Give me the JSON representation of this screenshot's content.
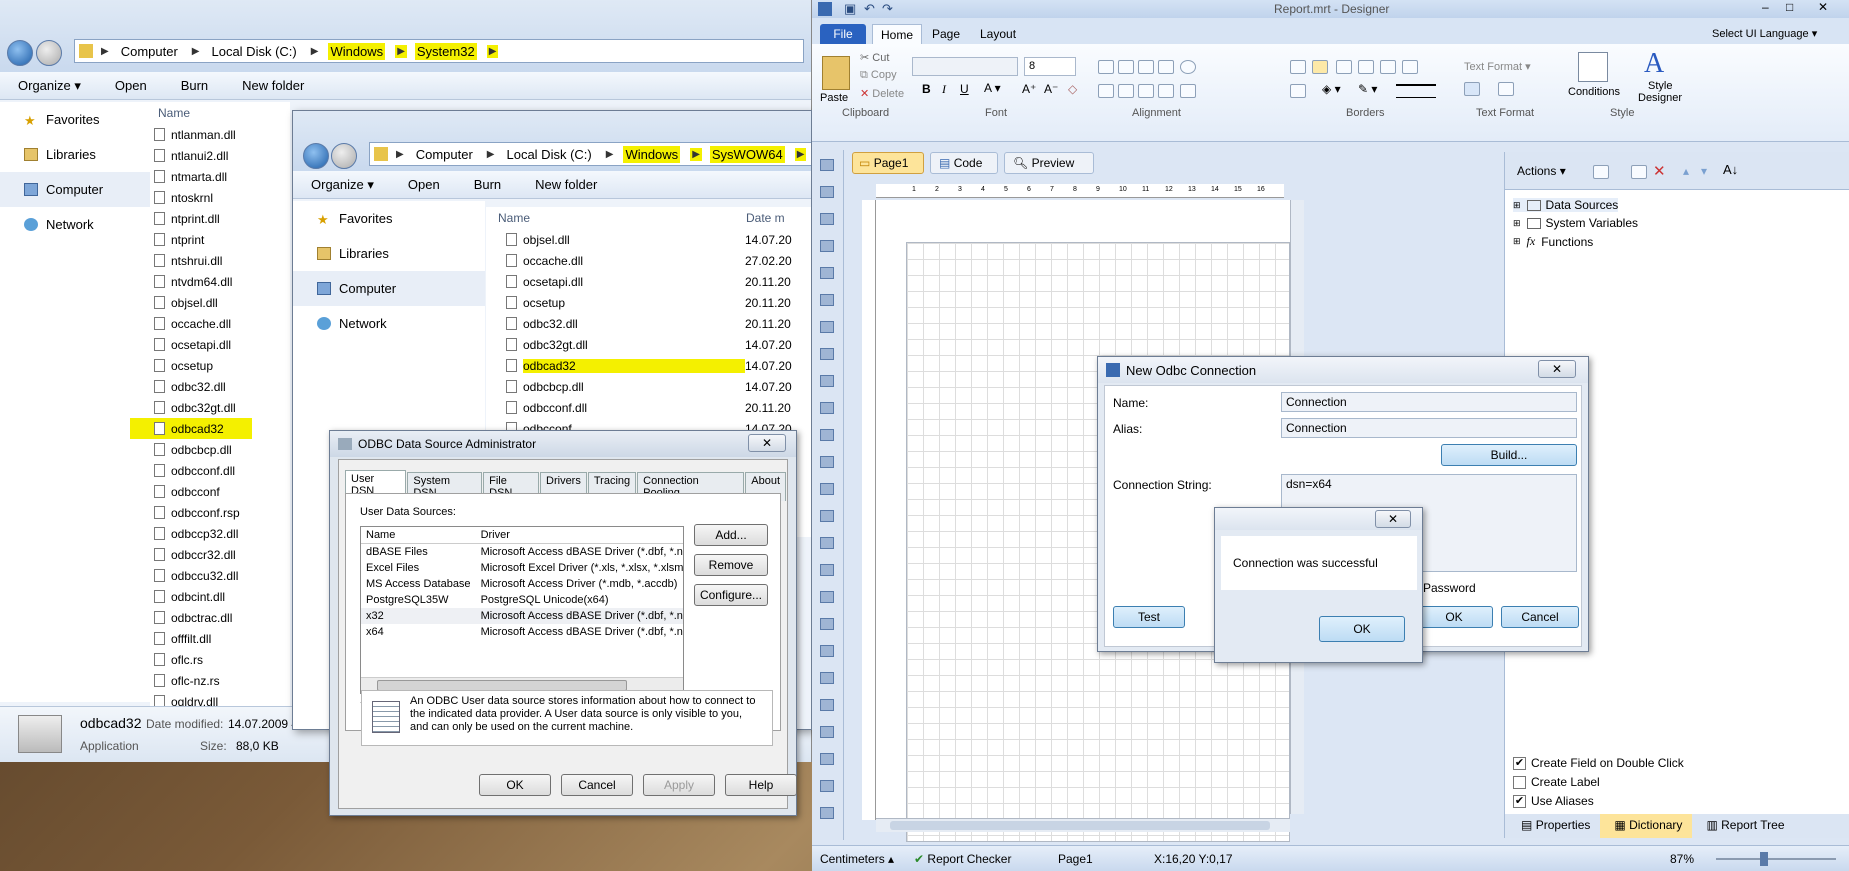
{
  "explorer1": {
    "crumbs": [
      "Computer",
      "Local Disk (C:)",
      "Windows",
      "System32"
    ],
    "toolbar": {
      "organize": "Organize",
      "open": "Open",
      "burn": "Burn",
      "new_folder": "New folder"
    },
    "nav": {
      "favorites": "Favorites",
      "libraries": "Libraries",
      "computer": "Computer",
      "network": "Network"
    },
    "col_name": "Name",
    "files": [
      "ntlanman.dll",
      "ntlanui2.dll",
      "ntmarta.dll",
      "ntoskrnl",
      "ntprint.dll",
      "ntprint",
      "ntshrui.dll",
      "ntvdm64.dll",
      "objsel.dll",
      "occache.dll",
      "ocsetapi.dll",
      "ocsetup",
      "odbc32.dll",
      "odbc32gt.dll",
      "odbcad32",
      "odbcbcp.dll",
      "odbcconf.dll",
      "odbcconf",
      "odbcconf.rsp",
      "odbccp32.dll",
      "odbccr32.dll",
      "odbccu32.dll",
      "odbcint.dll",
      "odbctrac.dll",
      "offfilt.dll",
      "oflc.rs",
      "oflc-nz.rs",
      "ogldrv.dll"
    ],
    "details": {
      "name": "odbcad32",
      "modified_label": "Date modified:",
      "modified": "14.07.2009 4",
      "type": "Application",
      "size_label": "Size:",
      "size": "88,0 KB"
    }
  },
  "explorer2": {
    "crumbs": [
      "Computer",
      "Local Disk (C:)",
      "Windows",
      "SysWOW64"
    ],
    "toolbar": {
      "organize": "Organize",
      "open": "Open",
      "burn": "Burn",
      "new_folder": "New folder"
    },
    "nav": {
      "favorites": "Favorites",
      "libraries": "Libraries",
      "computer": "Computer",
      "network": "Network"
    },
    "col_name": "Name",
    "col_date": "Date m",
    "files": [
      {
        "name": "objsel.dll",
        "date": "14.07.20"
      },
      {
        "name": "occache.dll",
        "date": "27.02.20"
      },
      {
        "name": "ocsetapi.dll",
        "date": "20.11.20"
      },
      {
        "name": "ocsetup",
        "date": "20.11.20"
      },
      {
        "name": "odbc32.dll",
        "date": "20.11.20"
      },
      {
        "name": "odbc32gt.dll",
        "date": "14.07.20"
      },
      {
        "name": "odbcad32",
        "date": "14.07.20"
      },
      {
        "name": "odbcbcp.dll",
        "date": "14.07.20"
      },
      {
        "name": "odbcconf.dll",
        "date": "20.11.20"
      },
      {
        "name": "odbcconf",
        "date": "14.07.20"
      }
    ]
  },
  "odbc_admin": {
    "title": "ODBC Data Source Administrator",
    "tabs": [
      "User DSN",
      "System DSN",
      "File DSN",
      "Drivers",
      "Tracing",
      "Connection Pooling",
      "About"
    ],
    "sources_label": "User Data Sources:",
    "col_name": "Name",
    "col_driver": "Driver",
    "rows": [
      {
        "name": "dBASE Files",
        "driver": "Microsoft Access dBASE Driver (*.dbf, *.ndx"
      },
      {
        "name": "Excel Files",
        "driver": "Microsoft Excel Driver (*.xls, *.xlsx, *.xlsm, *.x"
      },
      {
        "name": "MS Access Database",
        "driver": "Microsoft Access Driver (*.mdb, *.accdb)"
      },
      {
        "name": "PostgreSQL35W",
        "driver": "PostgreSQL Unicode(x64)"
      },
      {
        "name": "x32",
        "driver": "Microsoft Access dBASE Driver (*.dbf, *.ndx"
      },
      {
        "name": "x64",
        "driver": "Microsoft Access dBASE Driver (*.dbf, *.ndx"
      }
    ],
    "buttons": {
      "add": "Add...",
      "remove": "Remove",
      "configure": "Configure..."
    },
    "info_lines": [
      "An ODBC User data source stores information about how to connect to",
      "the indicated data provider.   A User data source is only visible to you,",
      "and can only be used on the current machine."
    ],
    "footer": {
      "ok": "OK",
      "cancel": "Cancel",
      "apply": "Apply",
      "help": "Help"
    }
  },
  "designer": {
    "title": "Report.mrt - Designer",
    "file_tab": "File",
    "ribbon_tabs": [
      "Home",
      "Page",
      "Layout"
    ],
    "select_language": "Select UI Language",
    "clipboard": {
      "paste": "Paste",
      "cut": "Cut",
      "copy": "Copy",
      "delete": "Delete",
      "label": "Clipboard"
    },
    "font": {
      "size": "8",
      "label": "Font"
    },
    "alignment_label": "Alignment",
    "borders_label": "Borders",
    "text_format": {
      "button": "Text Format",
      "label": "Text Format"
    },
    "style": {
      "conditions": "Conditions",
      "style_designer_1": "Style",
      "style_designer_2": "Designer",
      "label": "Style"
    },
    "doc_tabs": [
      "Page1",
      "Code",
      "Preview"
    ],
    "ruler_marks": [
      "1",
      "2",
      "3",
      "4",
      "5",
      "6",
      "7",
      "8",
      "9",
      "10",
      "11",
      "12",
      "13",
      "14",
      "15",
      "16"
    ],
    "dictionary": {
      "actions": "Actions",
      "tree": [
        "Data Sources",
        "System Variables",
        "Functions"
      ],
      "options": [
        {
          "label": "Create Field on Double Click",
          "checked": true
        },
        {
          "label": "Create Label",
          "checked": false
        },
        {
          "label": "Use Aliases",
          "checked": true
        }
      ],
      "tabs": [
        "Properties",
        "Dictionary",
        "Report Tree"
      ]
    },
    "status": {
      "units": "Centimeters",
      "checker": "Report Checker",
      "page": "Page1",
      "coords": "X:16,20  Y:0,17",
      "zoom": "87%"
    }
  },
  "odbc_conn": {
    "title": "New Odbc Connection",
    "name_label": "Name:",
    "name_value": "Connection",
    "alias_label": "Alias:",
    "alias_value": "Connection",
    "build": "Build...",
    "conn_label": "Connection String:",
    "conn_value": "dsn=x64",
    "password_hint": "Password",
    "test": "Test",
    "ok": "OK",
    "cancel": "Cancel"
  },
  "message": {
    "text": "Connection was successful",
    "ok": "OK"
  }
}
